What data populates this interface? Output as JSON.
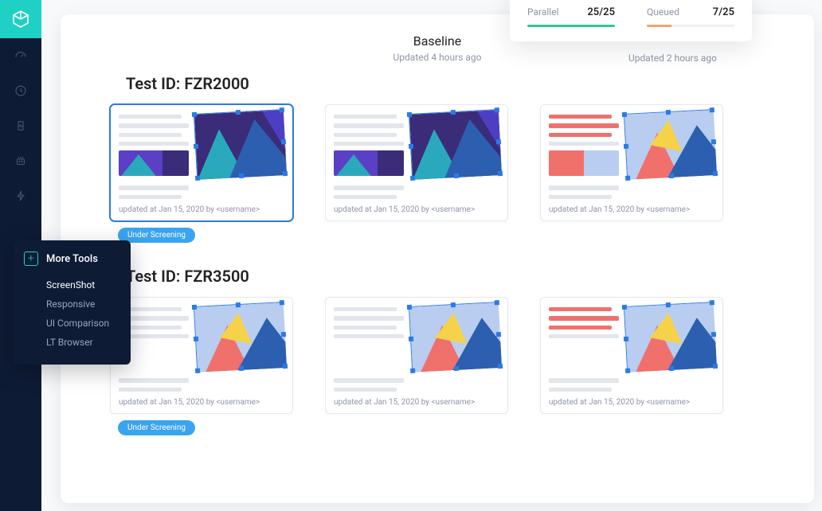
{
  "header": {
    "baseline_title": "Baseline",
    "updated_left": "Updated 4 hours ago",
    "updated_right": "Updated 2 hours ago"
  },
  "status": {
    "parallel_label": "Parallel",
    "parallel_value": "25/25",
    "queued_label": "Queued",
    "queued_value": "7/25"
  },
  "popover": {
    "title": "More Tools",
    "items": [
      "ScreenShot",
      "Responsive",
      "UI Comparison",
      "LT Browser"
    ]
  },
  "tests": [
    {
      "id_label": "Test ID: FZR2000",
      "badge": "Under Screening",
      "cards": [
        {
          "meta": "updated at Jan 15, 2020 by <username>",
          "variant": "purple",
          "selected": true
        },
        {
          "meta": "updated at Jan 15, 2020 by <username>",
          "variant": "purple",
          "selected": false
        },
        {
          "meta": "updated at Jan 15, 2020 by <username>",
          "variant": "red",
          "selected": false
        }
      ]
    },
    {
      "id_label": "Test ID: FZR3500",
      "badge": "Under Screening",
      "cards": [
        {
          "meta": "updated at Jan 15, 2020 by <username>",
          "variant": "light",
          "selected": false
        },
        {
          "meta": "updated at Jan 15, 2020 by <username>",
          "variant": "light",
          "selected": false
        },
        {
          "meta": "updated at Jan 15, 2020 by <username>",
          "variant": "lightred",
          "selected": false
        }
      ]
    }
  ]
}
